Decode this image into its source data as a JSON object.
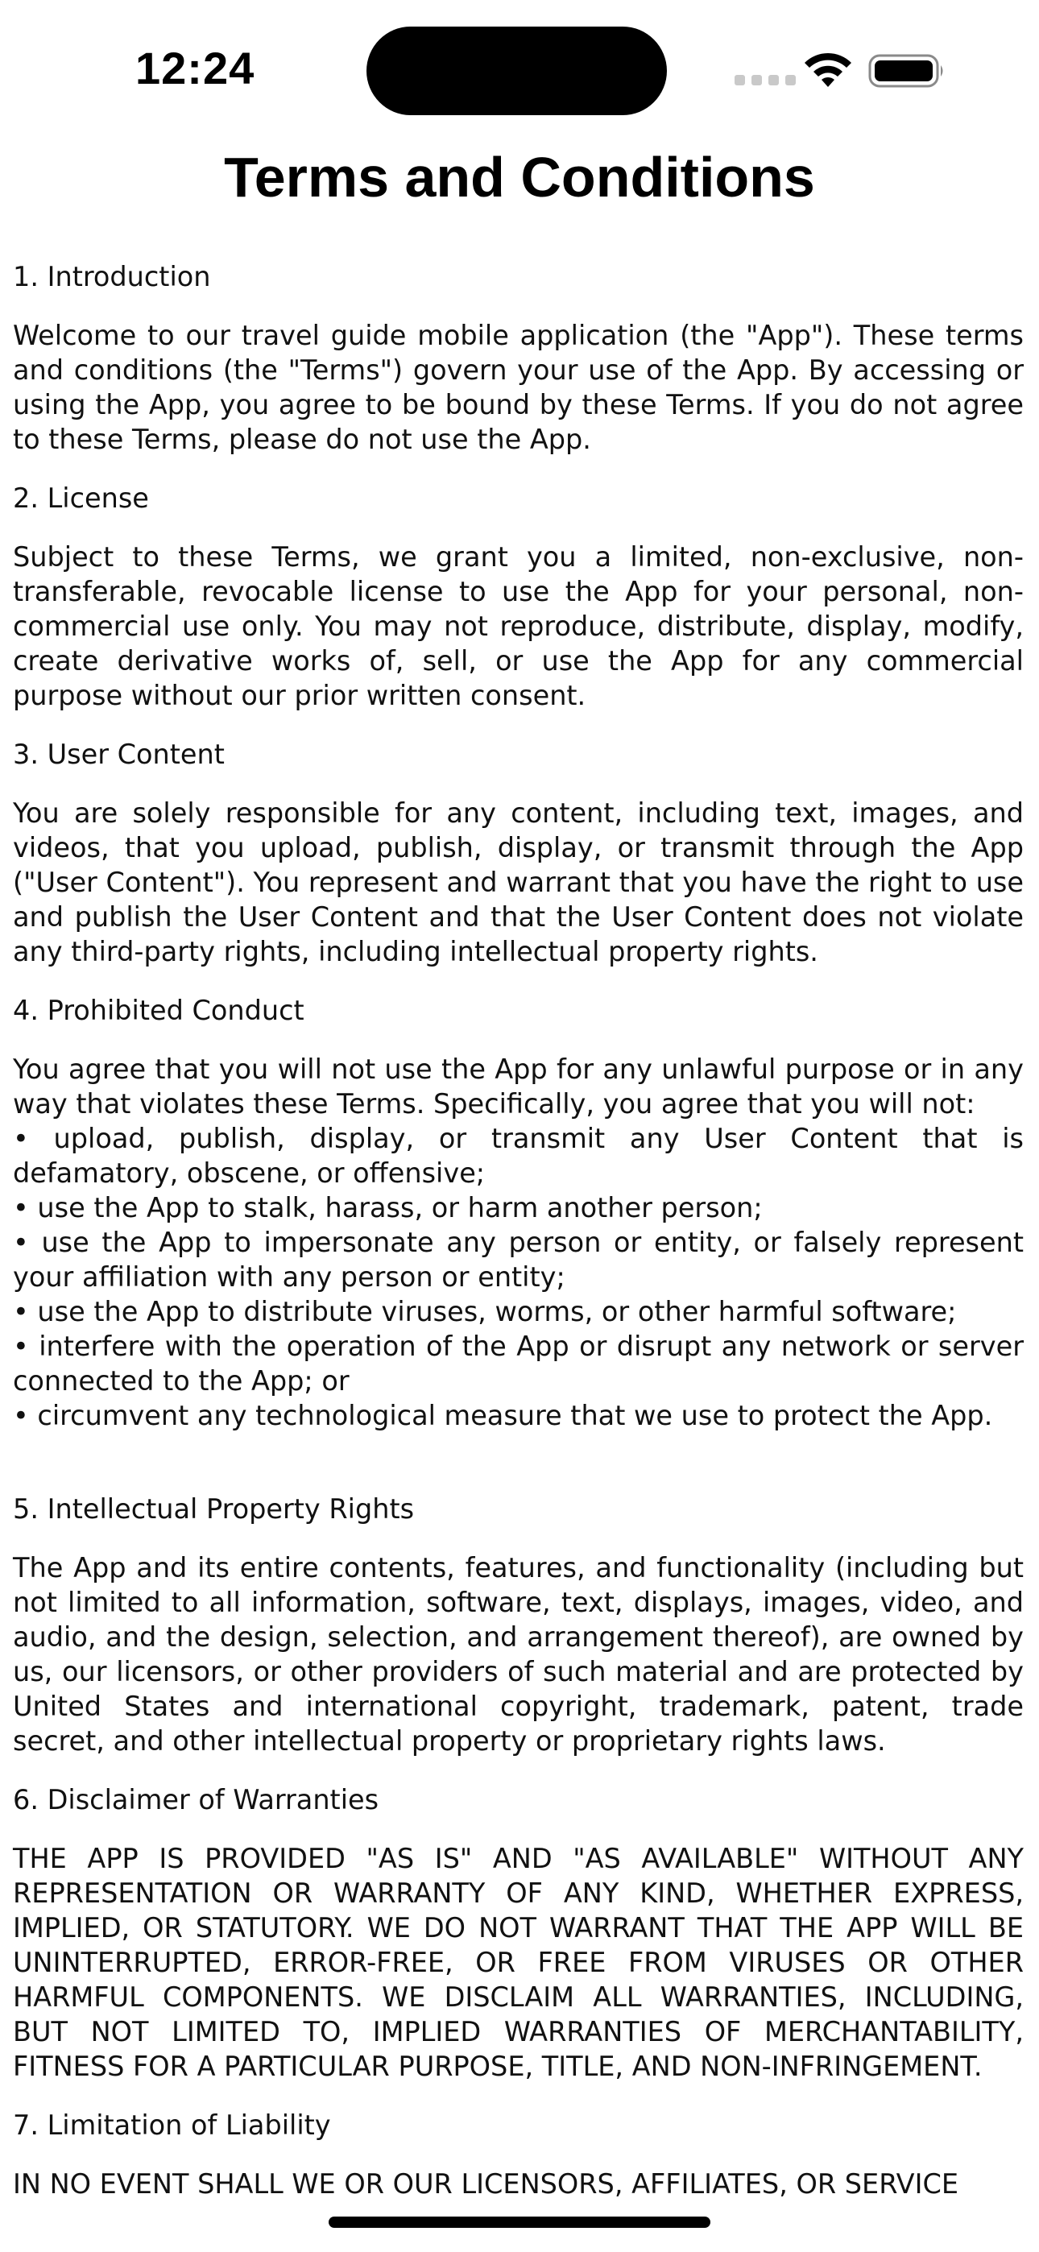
{
  "status_bar": {
    "time": "12:24"
  },
  "title": "Terms and Conditions",
  "sections": [
    {
      "heading": "1. Introduction",
      "body": "Welcome to our travel guide mobile application (the \"App\"). These terms and conditions (the \"Terms\") govern your use of the App. By accessing or using the App, you agree to be bound by these Terms. If you do not agree to these Terms, please do not use the App."
    },
    {
      "heading": "2. License",
      "body": "Subject to these Terms, we grant you a limited, non-exclusive, non-transferable, revocable license to use the App for your personal, non-commercial use only. You may not reproduce, distribute, display, modify, create derivative works of, sell, or use the App for any commercial purpose without our prior written consent."
    },
    {
      "heading": "3. User Content",
      "body": "You are solely responsible for any content, including text, images, and videos, that you upload, publish, display, or transmit through the App (\"User Content\"). You represent and warrant that you have the right to use and publish the User Content and that the User Content does not violate any third-party rights, including intellectual property rights."
    },
    {
      "heading": "4. Prohibited Conduct",
      "body": "You agree that you will not use the App for any unlawful purpose or in any way that violates these Terms. Specifically, you agree that you will not:",
      "bullets": [
        "upload, publish, display, or transmit any User Content that is defamatory, obscene, or offensive;",
        "use the App to stalk, harass, or harm another person;",
        "use the App to impersonate any person or entity, or falsely represent your affiliation with any person or entity;",
        "use the App to distribute viruses, worms, or other harmful software;",
        "interfere with the operation of the App or disrupt any network or server connected to the App; or",
        "circumvent any technological measure that we use to protect the App."
      ]
    },
    {
      "heading": "5. Intellectual Property Rights",
      "body": "The App and its entire contents, features, and functionality (including but not limited to all information, software, text, displays, images, video, and audio, and the design, selection, and arrangement thereof), are owned by us, our licensors, or other providers of such material and are protected by United States and international copyright, trademark, patent, trade secret, and other intellectual property or proprietary rights laws."
    },
    {
      "heading": "6. Disclaimer of Warranties",
      "body": "THE APP IS PROVIDED \"AS IS\" AND \"AS AVAILABLE\" WITHOUT ANY REPRESENTATION OR WARRANTY OF ANY KIND, WHETHER EXPRESS, IMPLIED, OR STATUTORY. WE DO NOT WARRANT THAT THE APP WILL BE UNINTERRUPTED, ERROR-FREE, OR FREE FROM VIRUSES OR OTHER HARMFUL COMPONENTS. WE DISCLAIM ALL WARRANTIES, INCLUDING, BUT NOT LIMITED TO, IMPLIED WARRANTIES OF MERCHANTABILITY, FITNESS FOR A PARTICULAR PURPOSE, TITLE, AND NON-INFRINGEMENT."
    },
    {
      "heading": "7. Limitation of Liability",
      "body": "IN NO EVENT SHALL WE OR OUR LICENSORS, AFFILIATES, OR SERVICE"
    }
  ],
  "icons": {
    "wifi": "wifi-icon",
    "battery": "battery-icon",
    "signal": "cellular-signal-icon"
  }
}
